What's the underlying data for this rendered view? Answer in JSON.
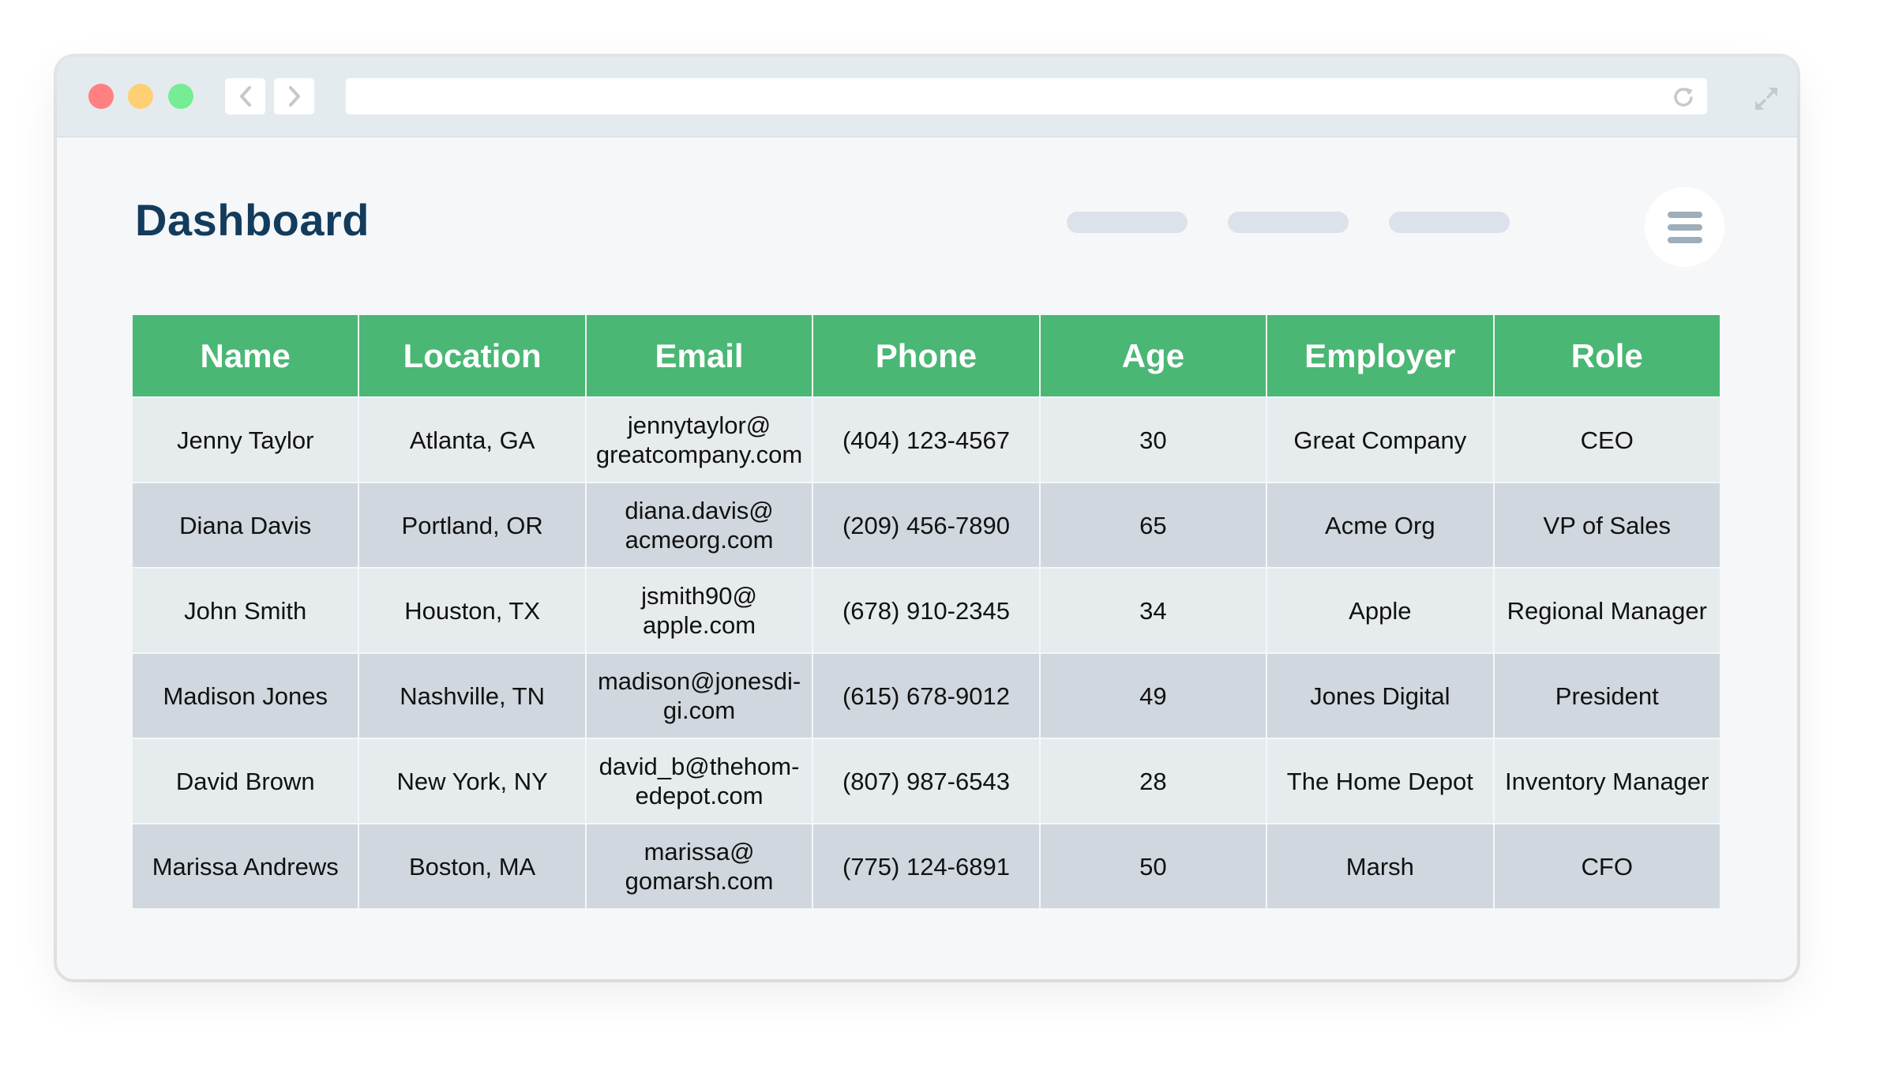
{
  "browser": {
    "window_controls": [
      "close",
      "minimize",
      "maximize"
    ],
    "address": "",
    "icons": {
      "back": "chevron-left-icon",
      "forward": "chevron-right-icon",
      "reload": "reload-icon",
      "expand": "expand-icon"
    }
  },
  "header": {
    "title": "Dashboard",
    "nav_placeholders": 3,
    "menu_icon": "hamburger-menu-icon"
  },
  "colors": {
    "header_green": "#4ab774",
    "title_navy": "#133b5c",
    "row_light": "#e6ebee",
    "row_dark": "#d0d7de"
  },
  "table": {
    "columns": [
      "Name",
      "Location",
      "Email",
      "Phone",
      "Age",
      "Employer",
      "Role"
    ],
    "rows": [
      {
        "name": "Jenny Taylor",
        "location": "Atlanta, GA",
        "email": "jennytaylor@\ngreatcompany.com",
        "phone": "(404) 123-4567",
        "age": "30",
        "employer": "Great Company",
        "role": "CEO"
      },
      {
        "name": "Diana Davis",
        "location": "Portland, OR",
        "email": "diana.davis@\nacmeorg.com",
        "phone": "(209) 456-7890",
        "age": "65",
        "employer": "Acme Org",
        "role": "VP of Sales"
      },
      {
        "name": "John Smith",
        "location": "Houston, TX",
        "email": "jsmith90@\napple.com",
        "phone": "(678) 910-2345",
        "age": "34",
        "employer": "Apple",
        "role": "Regional Manager"
      },
      {
        "name": "Madison Jones",
        "location": "Nashville, TN",
        "email": "madison@jonesdi-\ngi.com",
        "phone": "(615) 678-9012",
        "age": "49",
        "employer": "Jones Digital",
        "role": "President"
      },
      {
        "name": "David Brown",
        "location": "New York, NY",
        "email": "david_b@thehom-\nedepot.com",
        "phone": "(807) 987-6543",
        "age": "28",
        "employer": "The Home Depot",
        "role": "Inventory Manager"
      },
      {
        "name": "Marissa Andrews",
        "location": "Boston, MA",
        "email": "marissa@\ngomarsh.com",
        "phone": "(775) 124-6891",
        "age": "50",
        "employer": "Marsh",
        "role": "CFO"
      }
    ]
  }
}
